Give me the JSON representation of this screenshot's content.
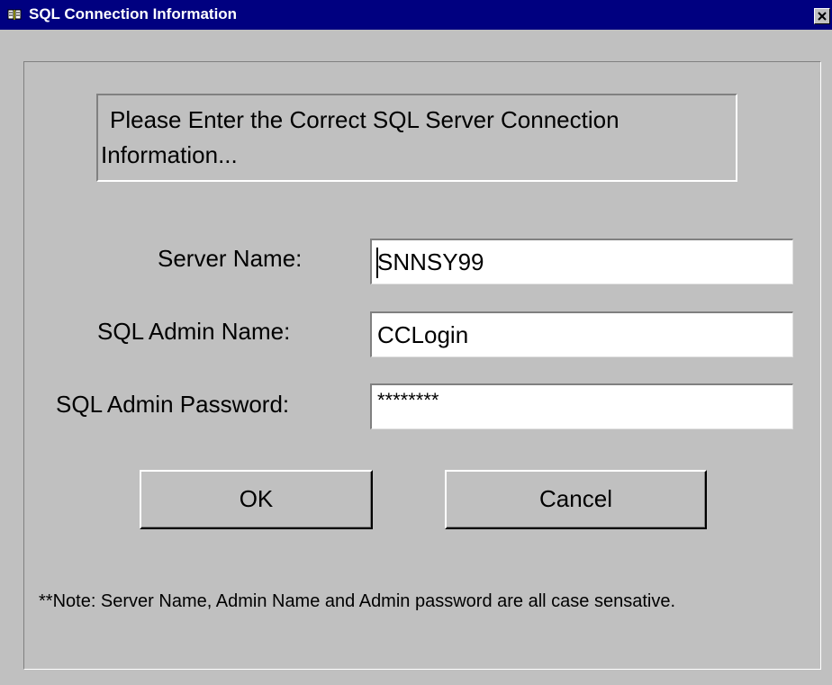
{
  "window": {
    "title": "SQL Connection Information",
    "icon": "book-icon",
    "close_symbol": "×"
  },
  "message": "Please Enter the Correct SQL Server Connection Information...",
  "fields": {
    "server_name": {
      "label": "Server Name:",
      "value": "SNNSY99"
    },
    "admin_name": {
      "label": "SQL Admin Name:",
      "value": "CCLogin"
    },
    "admin_password": {
      "label": "SQL Admin Password:",
      "value": "********"
    }
  },
  "buttons": {
    "ok": "OK",
    "cancel": "Cancel"
  },
  "note": "**Note: Server Name, Admin Name and Admin password are all case sensative.",
  "colors": {
    "titlebar": "#000080",
    "face": "#c0c0c0",
    "field": "#ffffff"
  }
}
